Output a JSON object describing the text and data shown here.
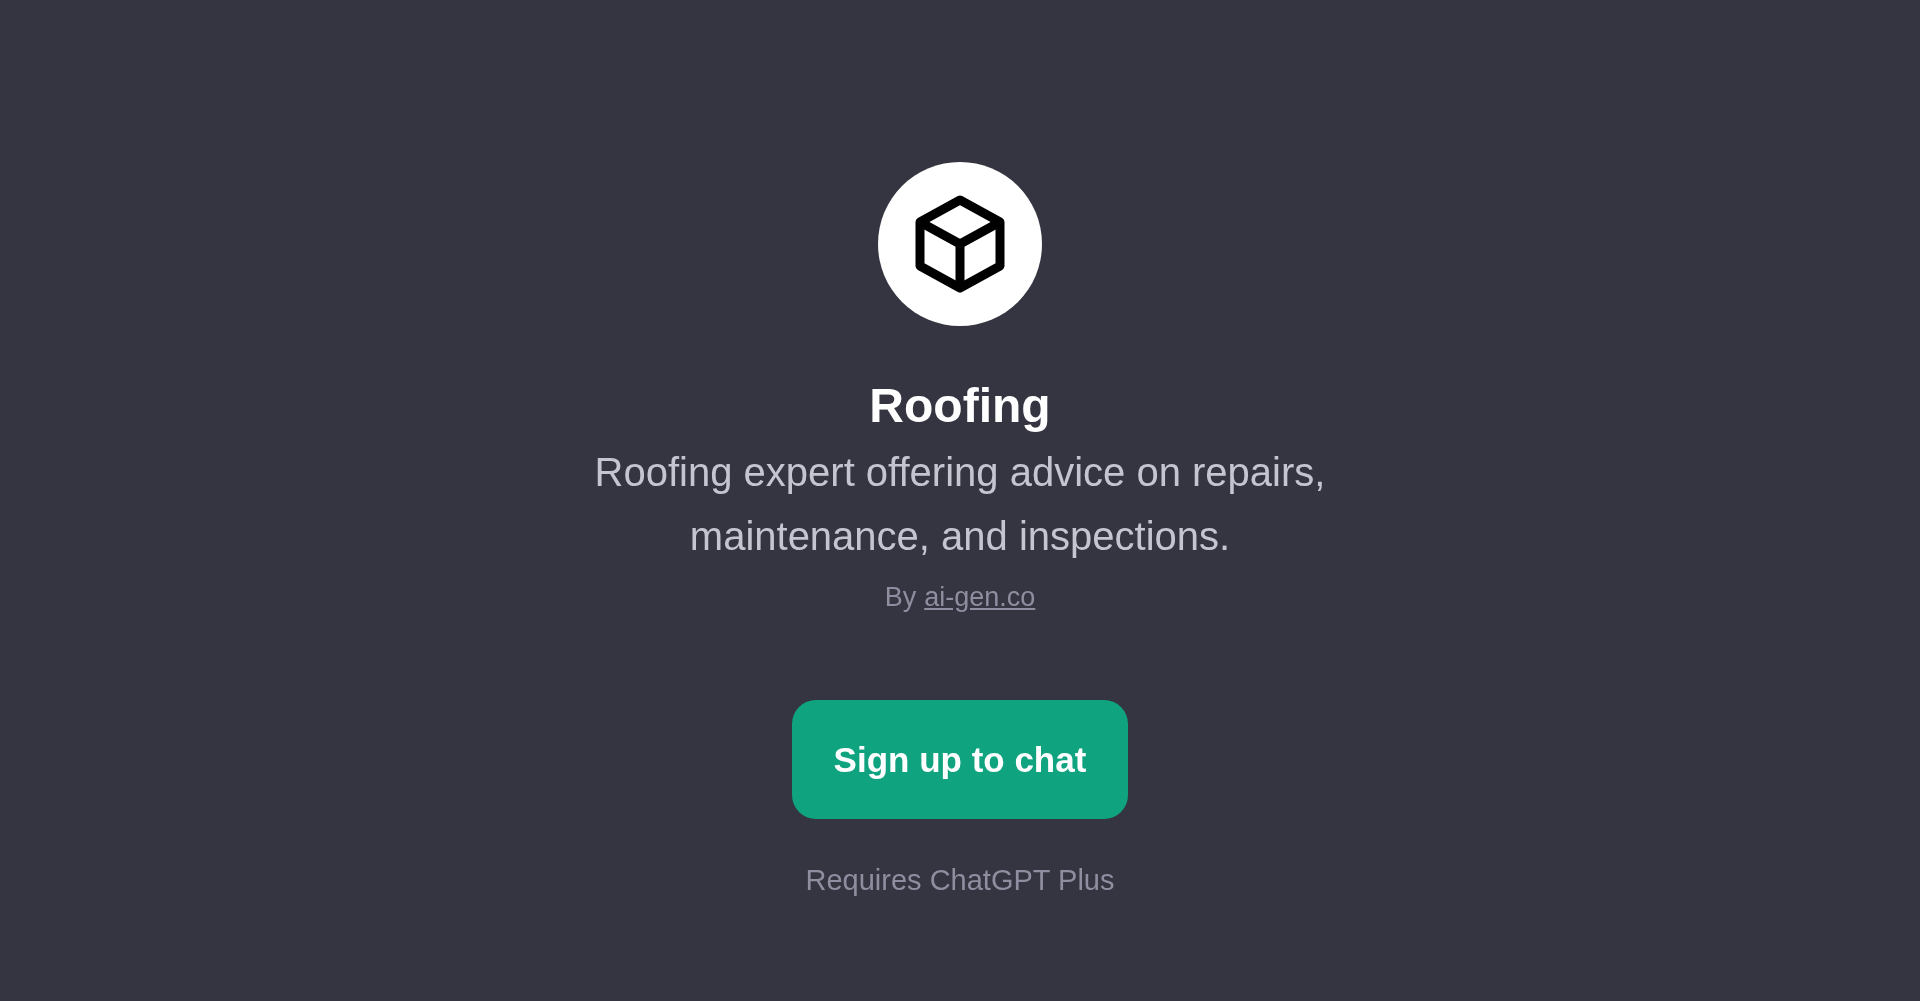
{
  "title": "Roofing",
  "description": "Roofing expert offering advice on repairs, maintenance, and inspections.",
  "author": {
    "prefix": "By",
    "link": "ai-gen.co"
  },
  "button": "Sign up to chat",
  "note": "Requires ChatGPT Plus"
}
